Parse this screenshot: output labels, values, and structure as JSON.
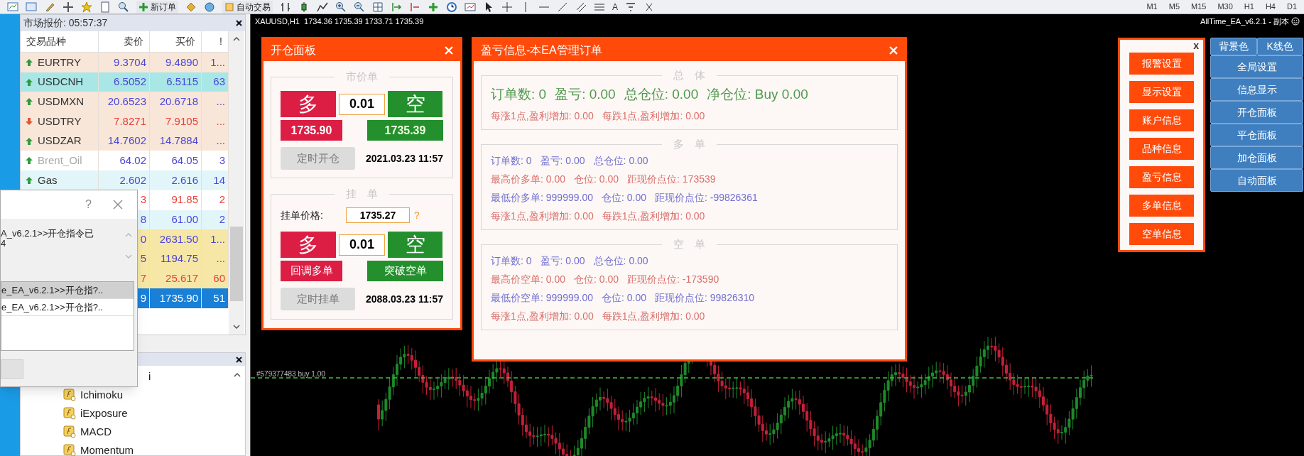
{
  "toolbar": {
    "new_order": "新订单",
    "auto_trading": "自动交易",
    "text_tool": "A",
    "timeframes": [
      "M1",
      "M5",
      "M15",
      "M30",
      "H1",
      "H4",
      "D1"
    ]
  },
  "market_watch": {
    "title": "市场报价: 05:57:37",
    "columns": [
      "交易品种",
      "卖价",
      "买价",
      "!"
    ],
    "rows": [
      {
        "symbol": "EURTRY",
        "bid": "9.3704",
        "ask": "9.4890",
        "spread": "1...",
        "falling": false,
        "dimmed": false,
        "color": "#f8e6d8",
        "selected": false
      },
      {
        "symbol": "USDCNH",
        "bid": "6.5052",
        "ask": "6.5115",
        "spread": "63",
        "falling": false,
        "dimmed": false,
        "color": "#a9e6e6",
        "selected": false
      },
      {
        "symbol": "USDMXN",
        "bid": "20.6523",
        "ask": "20.6718",
        "spread": "...",
        "falling": false,
        "dimmed": false,
        "color": "#f8e6d8",
        "selected": false
      },
      {
        "symbol": "USDTRY",
        "bid": "7.8271",
        "ask": "7.9105",
        "spread": "...",
        "falling": true,
        "dimmed": false,
        "color": "#f8e6d8",
        "selected": false
      },
      {
        "symbol": "USDZAR",
        "bid": "14.7602",
        "ask": "14.7884",
        "spread": "...",
        "falling": false,
        "dimmed": false,
        "color": "#f8e6d8",
        "selected": false
      },
      {
        "symbol": "Brent_Oil",
        "bid": "64.02",
        "ask": "64.05",
        "spread": "3",
        "falling": false,
        "dimmed": true,
        "color": "#ffffff",
        "selected": false
      },
      {
        "symbol": "Gas",
        "bid": "2.602",
        "ask": "2.616",
        "spread": "14",
        "falling": false,
        "dimmed": false,
        "color": "#e2f6fa",
        "selected": false
      },
      {
        "bid": "3",
        "ask": "91.85",
        "spread": "2",
        "falling": true,
        "color": "#ffffff",
        "selected": false
      },
      {
        "bid": "8",
        "ask": "61.00",
        "spread": "2",
        "falling": false,
        "color": "#e2f6fa",
        "selected": false
      },
      {
        "bid": "0",
        "ask": "2631.50",
        "spread": "1...",
        "falling": false,
        "color": "#f6e7a6",
        "selected": false
      },
      {
        "bid": "5",
        "ask": "1194.75",
        "spread": "...",
        "falling": false,
        "color": "#f6e7a6",
        "selected": false
      },
      {
        "bid": "7",
        "ask": "25.617",
        "spread": "60",
        "falling": true,
        "color": "#f6e7a6",
        "selected": false
      },
      {
        "bid": "9",
        "ask": "1735.90",
        "spread": "51",
        "color": "#1a7fd6",
        "selected": true
      }
    ]
  },
  "alert_dialog": {
    "help": "?",
    "message": [
      "A_v6.2.1>>开仓指令已",
      "4"
    ],
    "log": [
      {
        "text": "e_EA_v6.2.1>>开仓指?..",
        "selected": true
      },
      {
        "text": "e_EA_v6.2.1>>开仓指?..",
        "selected": false
      }
    ]
  },
  "navigator": {
    "cut_item": "i",
    "items": [
      "Ichimoku",
      "iExposure",
      "MACD",
      "Momentum"
    ]
  },
  "chart": {
    "title": "XAUUSD,H1  1734.36 1735.39 1733.71 1735.39",
    "ea_label": "AllTime_EA_v6.2.1 - 副本",
    "order_line": "#579377483 buy 1.00"
  },
  "open_panel": {
    "title": "开仓面板",
    "market": {
      "legend": "市价单",
      "buy": "多",
      "lots": "0.01",
      "sell": "空",
      "buy_price": "1735.90",
      "sell_price": "1735.39",
      "timer_button": {
        "label": "定时开仓",
        "disabled": true
      },
      "time": "2021.03.23 11:57"
    },
    "pending": {
      "legend": "挂　单",
      "price_label": "挂单价格:",
      "price": "1735.27",
      "help": "?",
      "buy": "多",
      "lots": "0.01",
      "sell": "空",
      "buy_order": "回调多单",
      "sell_order": "突破空单",
      "timer_button": {
        "label": "定时挂单",
        "disabled": true
      },
      "time": "2088.03.23 11:57"
    }
  },
  "pnl_panel": {
    "title": "盈亏信息-本EA管理订单",
    "sections": [
      {
        "legend": "总　体",
        "lines": [
          {
            "color": "#4e9a4e",
            "large": true,
            "parts": [
              "订单数: 0",
              "盈亏: 0.00",
              "总仓位: 0.00",
              "净仓位: Buy 0.00"
            ]
          },
          {
            "color": "#d9706c",
            "large": false,
            "parts": [
              "每涨1点,盈利增加: 0.00",
              "每跌1点,盈利增加: 0.00"
            ]
          }
        ]
      },
      {
        "legend": "多　单",
        "lines": [
          {
            "color": "#7070d0",
            "large": false,
            "parts": [
              "订单数: 0",
              "盈亏: 0.00",
              "总仓位: 0.00"
            ]
          },
          {
            "color": "#d9706c",
            "large": false,
            "parts": [
              "最高价多单: 0.00",
              "仓位: 0.00",
              "距现价点位: 173539"
            ]
          },
          {
            "color": "#7070d0",
            "large": false,
            "parts": [
              "最低价多单: 999999.00",
              "仓位: 0.00",
              "距现价点位: -99826361"
            ]
          },
          {
            "color": "#d9706c",
            "large": false,
            "parts": [
              "每涨1点,盈利增加: 0.00",
              "每跌1点,盈利增加: 0.00"
            ]
          }
        ]
      },
      {
        "legend": "空　单",
        "lines": [
          {
            "color": "#7070d0",
            "large": false,
            "parts": [
              "订单数: 0",
              "盈亏: 0.00",
              "总仓位: 0.00"
            ]
          },
          {
            "color": "#d9706c",
            "large": false,
            "parts": [
              "最高价空单: 0.00",
              "仓位: 0.00",
              "距现价点位: -173590"
            ]
          },
          {
            "color": "#7070d0",
            "large": false,
            "parts": [
              "最低价空单: 999999.00",
              "仓位: 0.00",
              "距现价点位: 99826310"
            ]
          },
          {
            "color": "#d9706c",
            "large": false,
            "parts": [
              "每涨1点,盈利增加: 0.00",
              "每跌1点,盈利增加: 0.00"
            ]
          }
        ]
      }
    ]
  },
  "menu_panel": {
    "close": "x",
    "buttons": [
      "报警设置",
      "显示设置",
      "账户信息",
      "品种信息",
      "盈亏信息",
      "多单信息",
      "空单信息"
    ]
  },
  "control_panel": {
    "rows": [
      [
        "背景色",
        "K线色"
      ],
      [
        "全局设置"
      ],
      [
        "信息显示"
      ],
      [
        "开仓面板"
      ],
      [
        "平仓面板"
      ],
      [
        "加仓面板"
      ],
      [
        "自动面板"
      ]
    ]
  }
}
